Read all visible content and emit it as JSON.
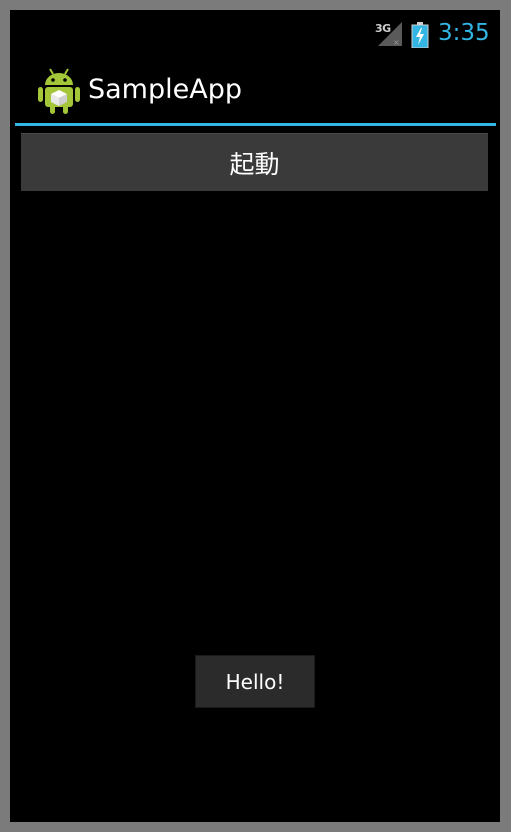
{
  "status_bar": {
    "network_type": "3G",
    "time": "3:35",
    "signal_icon": "signal-no-data-icon",
    "battery_icon": "battery-charging-icon"
  },
  "action_bar": {
    "title": "SampleApp",
    "icon": "android-app-icon",
    "divider_color": "#33b5e5"
  },
  "main": {
    "launch_button_label": "起動"
  },
  "toast": {
    "message": "Hello!"
  },
  "colors": {
    "accent": "#33b5e5",
    "background": "#000000",
    "button": "#3a3a3a"
  }
}
